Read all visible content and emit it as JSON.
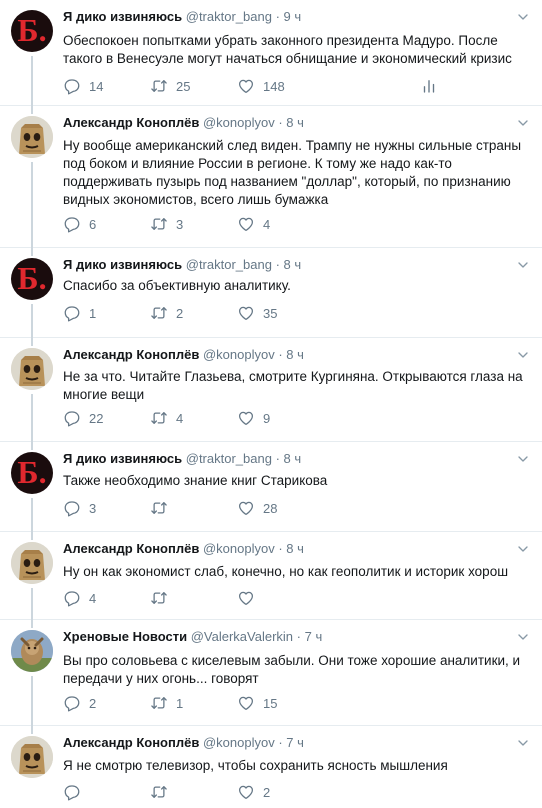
{
  "tweets": [
    {
      "name": "Я дико извиняюсь",
      "handle": "@traktor_bang",
      "dot": "·",
      "time": "9 ч",
      "avatar": "b-logo",
      "text": "Обеспокоен попытками убрать законного президента Мадуро. После такого в Венесуэле могут начаться обнищание и экономический кризис",
      "replies": "14",
      "retweets": "25",
      "likes": "148"
    },
    {
      "name": "Александр Коноплёв",
      "handle": "@konoplyov",
      "dot": "·",
      "time": "8 ч",
      "avatar": "paper-bag",
      "text": "Ну вообще американский след виден. Трампу не нужны сильные страны под боком и влияние России в регионе. К тому же надо как-то поддерживать пузырь под названием \"доллар\", который, по признанию видных экономистов, всего лишь бумажка",
      "replies": "6",
      "retweets": "3",
      "likes": "4"
    },
    {
      "name": "Я дико извиняюсь",
      "handle": "@traktor_bang",
      "dot": "·",
      "time": "8 ч",
      "avatar": "b-logo",
      "text": "Спасибо за объективную аналитику.",
      "replies": "1",
      "retweets": "2",
      "likes": "35"
    },
    {
      "name": "Александр Коноплёв",
      "handle": "@konoplyov",
      "dot": "·",
      "time": "8 ч",
      "avatar": "paper-bag",
      "text": "Не за что. Читайте Глазьева, смотрите Кургиняна. Открываются глаза на многие вещи",
      "replies": "22",
      "retweets": "4",
      "likes": "9"
    },
    {
      "name": "Я дико извиняюсь",
      "handle": "@traktor_bang",
      "dot": "·",
      "time": "8 ч",
      "avatar": "b-logo",
      "text": "Также необходимо знание книг Старикова",
      "replies": "3",
      "retweets": "",
      "likes": "28"
    },
    {
      "name": "Александр Коноплёв",
      "handle": "@konoplyov",
      "dot": "·",
      "time": "8 ч",
      "avatar": "paper-bag",
      "text": "Ну он как экономист слаб, конечно, но как геополитик и историк хорош",
      "replies": "4",
      "retweets": "",
      "likes": ""
    },
    {
      "name": "Хреновые Новости",
      "handle": "@ValerkaValerkin",
      "dot": "·",
      "time": "7 ч",
      "avatar": "news-photo",
      "text": "Вы про соловьева с киселевым забыли. Они тоже хорошие аналитики, и передачи у них огонь... говорят",
      "replies": "2",
      "retweets": "1",
      "likes": "15"
    },
    {
      "name": "Александр Коноплёв",
      "handle": "@konoplyov",
      "dot": "·",
      "time": "7 ч",
      "avatar": "paper-bag",
      "text": "Я не смотрю телевизор, чтобы сохранить ясность мышления",
      "replies": "",
      "retweets": "",
      "likes": "2"
    }
  ],
  "b_logo_letter": "Б.",
  "colors": {
    "text": "#14171a",
    "secondary": "#657786",
    "divider": "#e6ecf0",
    "thread_line": "#ccd6dd",
    "logo_red": "#e0282e"
  },
  "icons": [
    "reply-icon",
    "retweet-icon",
    "like-icon",
    "analytics-icon",
    "chevron-down-icon"
  ]
}
